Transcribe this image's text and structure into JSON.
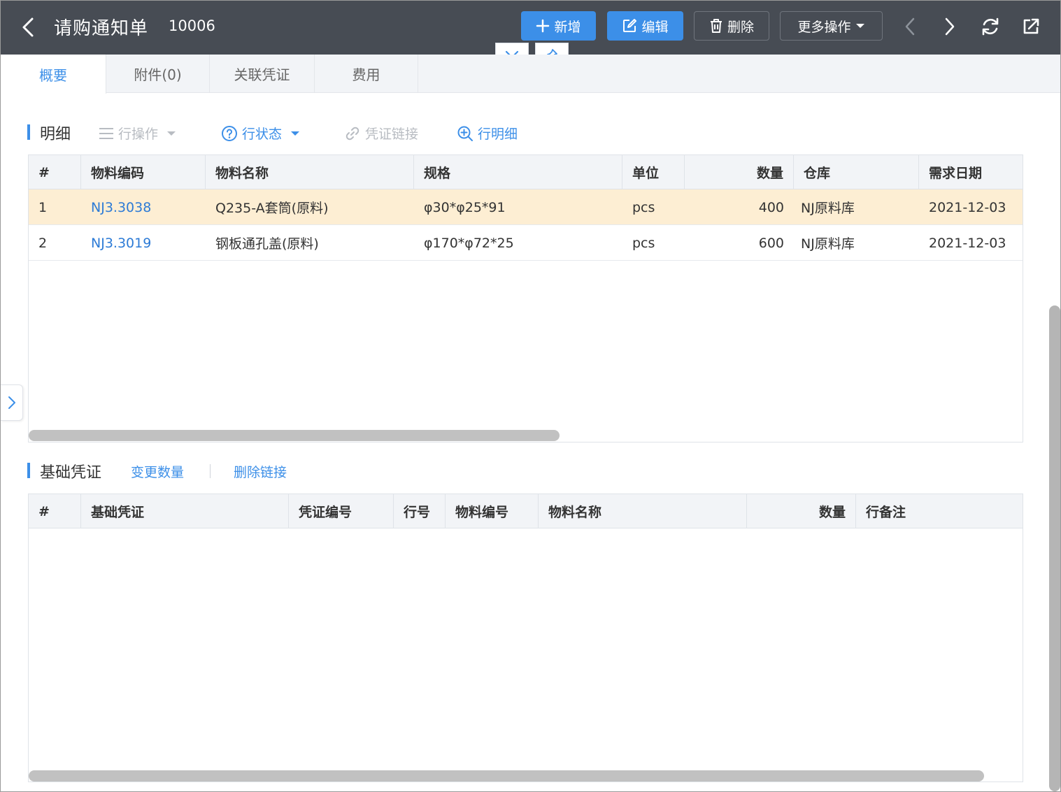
{
  "header": {
    "title": "请购通知单",
    "doc_no": "10006",
    "buttons": {
      "add": "新增",
      "edit": "编辑",
      "delete": "删除",
      "more": "更多操作"
    }
  },
  "tabs": [
    {
      "label": "概要",
      "active": true
    },
    {
      "label": "附件(0)",
      "active": false
    },
    {
      "label": "关联凭证",
      "active": false
    },
    {
      "label": "费用",
      "active": false
    }
  ],
  "detail": {
    "title": "明细",
    "tools": {
      "row_ops": "行操作",
      "row_status": "行状态",
      "voucher_link": "凭证链接",
      "row_detail": "行明细"
    },
    "columns": [
      "#",
      "物料编码",
      "物料名称",
      "规格",
      "单位",
      "数量",
      "仓库",
      "需求日期"
    ],
    "rows": [
      {
        "no": "1",
        "code": "NJ3.3038",
        "name": "Q235-A套筒(原料)",
        "spec": "φ30*φ25*91",
        "unit": "pcs",
        "qty": "400",
        "warehouse": "NJ原料库",
        "date": "2021-12-03",
        "selected": true
      },
      {
        "no": "2",
        "code": "NJ3.3019",
        "name": "钢板通孔盖(原料)",
        "spec": "φ170*φ72*25",
        "unit": "pcs",
        "qty": "600",
        "warehouse": "NJ原料库",
        "date": "2021-12-03",
        "selected": false
      }
    ]
  },
  "base": {
    "title": "基础凭证",
    "tools": {
      "change_qty": "变更数量",
      "delete_link": "删除链接"
    },
    "columns": [
      "#",
      "基础凭证",
      "凭证编号",
      "行号",
      "物料编号",
      "物料名称",
      "数量",
      "行备注"
    ]
  },
  "colors": {
    "header_bg": "#474c54",
    "accent": "#3c8fe8",
    "selected_row": "#fdeed3"
  }
}
